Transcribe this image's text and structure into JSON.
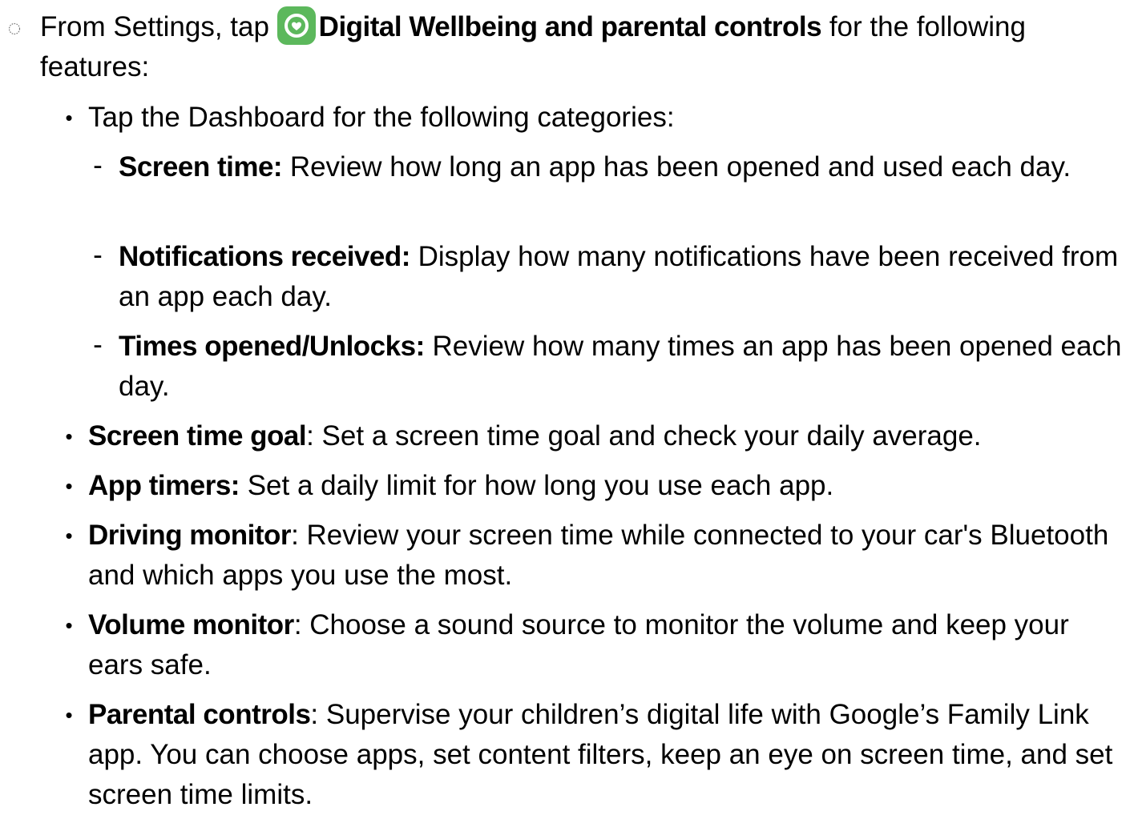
{
  "intro": {
    "prefix": "From Settings, tap ",
    "app_name": "Digital Wellbeing and parental controls",
    "suffix": " for the following features:",
    "icon_color": "#5CB85C"
  },
  "bullets": [
    {
      "text": "Tap the Dashboard for the following categories:"
    },
    {
      "bold": "Screen time goal",
      "text": ": Set a screen time goal and check your daily average."
    },
    {
      "bold": "App timers:",
      "text": " Set a daily limit for how long you use each app."
    },
    {
      "bold": "Driving monitor",
      "text": ": Review your screen time while connected to your car's Bluetooth and which apps you use the most."
    },
    {
      "bold": "Volume monitor",
      "text": ": Choose a sound source to monitor the volume and keep your ears safe."
    },
    {
      "bold": "Parental controls",
      "text": ": Supervise your children’s digital life with Google’s Family Link app. You can choose apps, set content filters, keep an eye on screen time, and set screen time limits."
    }
  ],
  "dashboard_items": [
    {
      "bold": "Screen time:",
      "text": " Review how long an app has been opened and used each day."
    },
    {
      "bold": "Notifications received:",
      "text": " Display how many notifications have been received from an app each day."
    },
    {
      "bold": "Times opened/Unlocks:",
      "text": " Review how many times an app has been opened each day."
    }
  ],
  "markers": {
    "bullet": "•",
    "dash": "-"
  }
}
